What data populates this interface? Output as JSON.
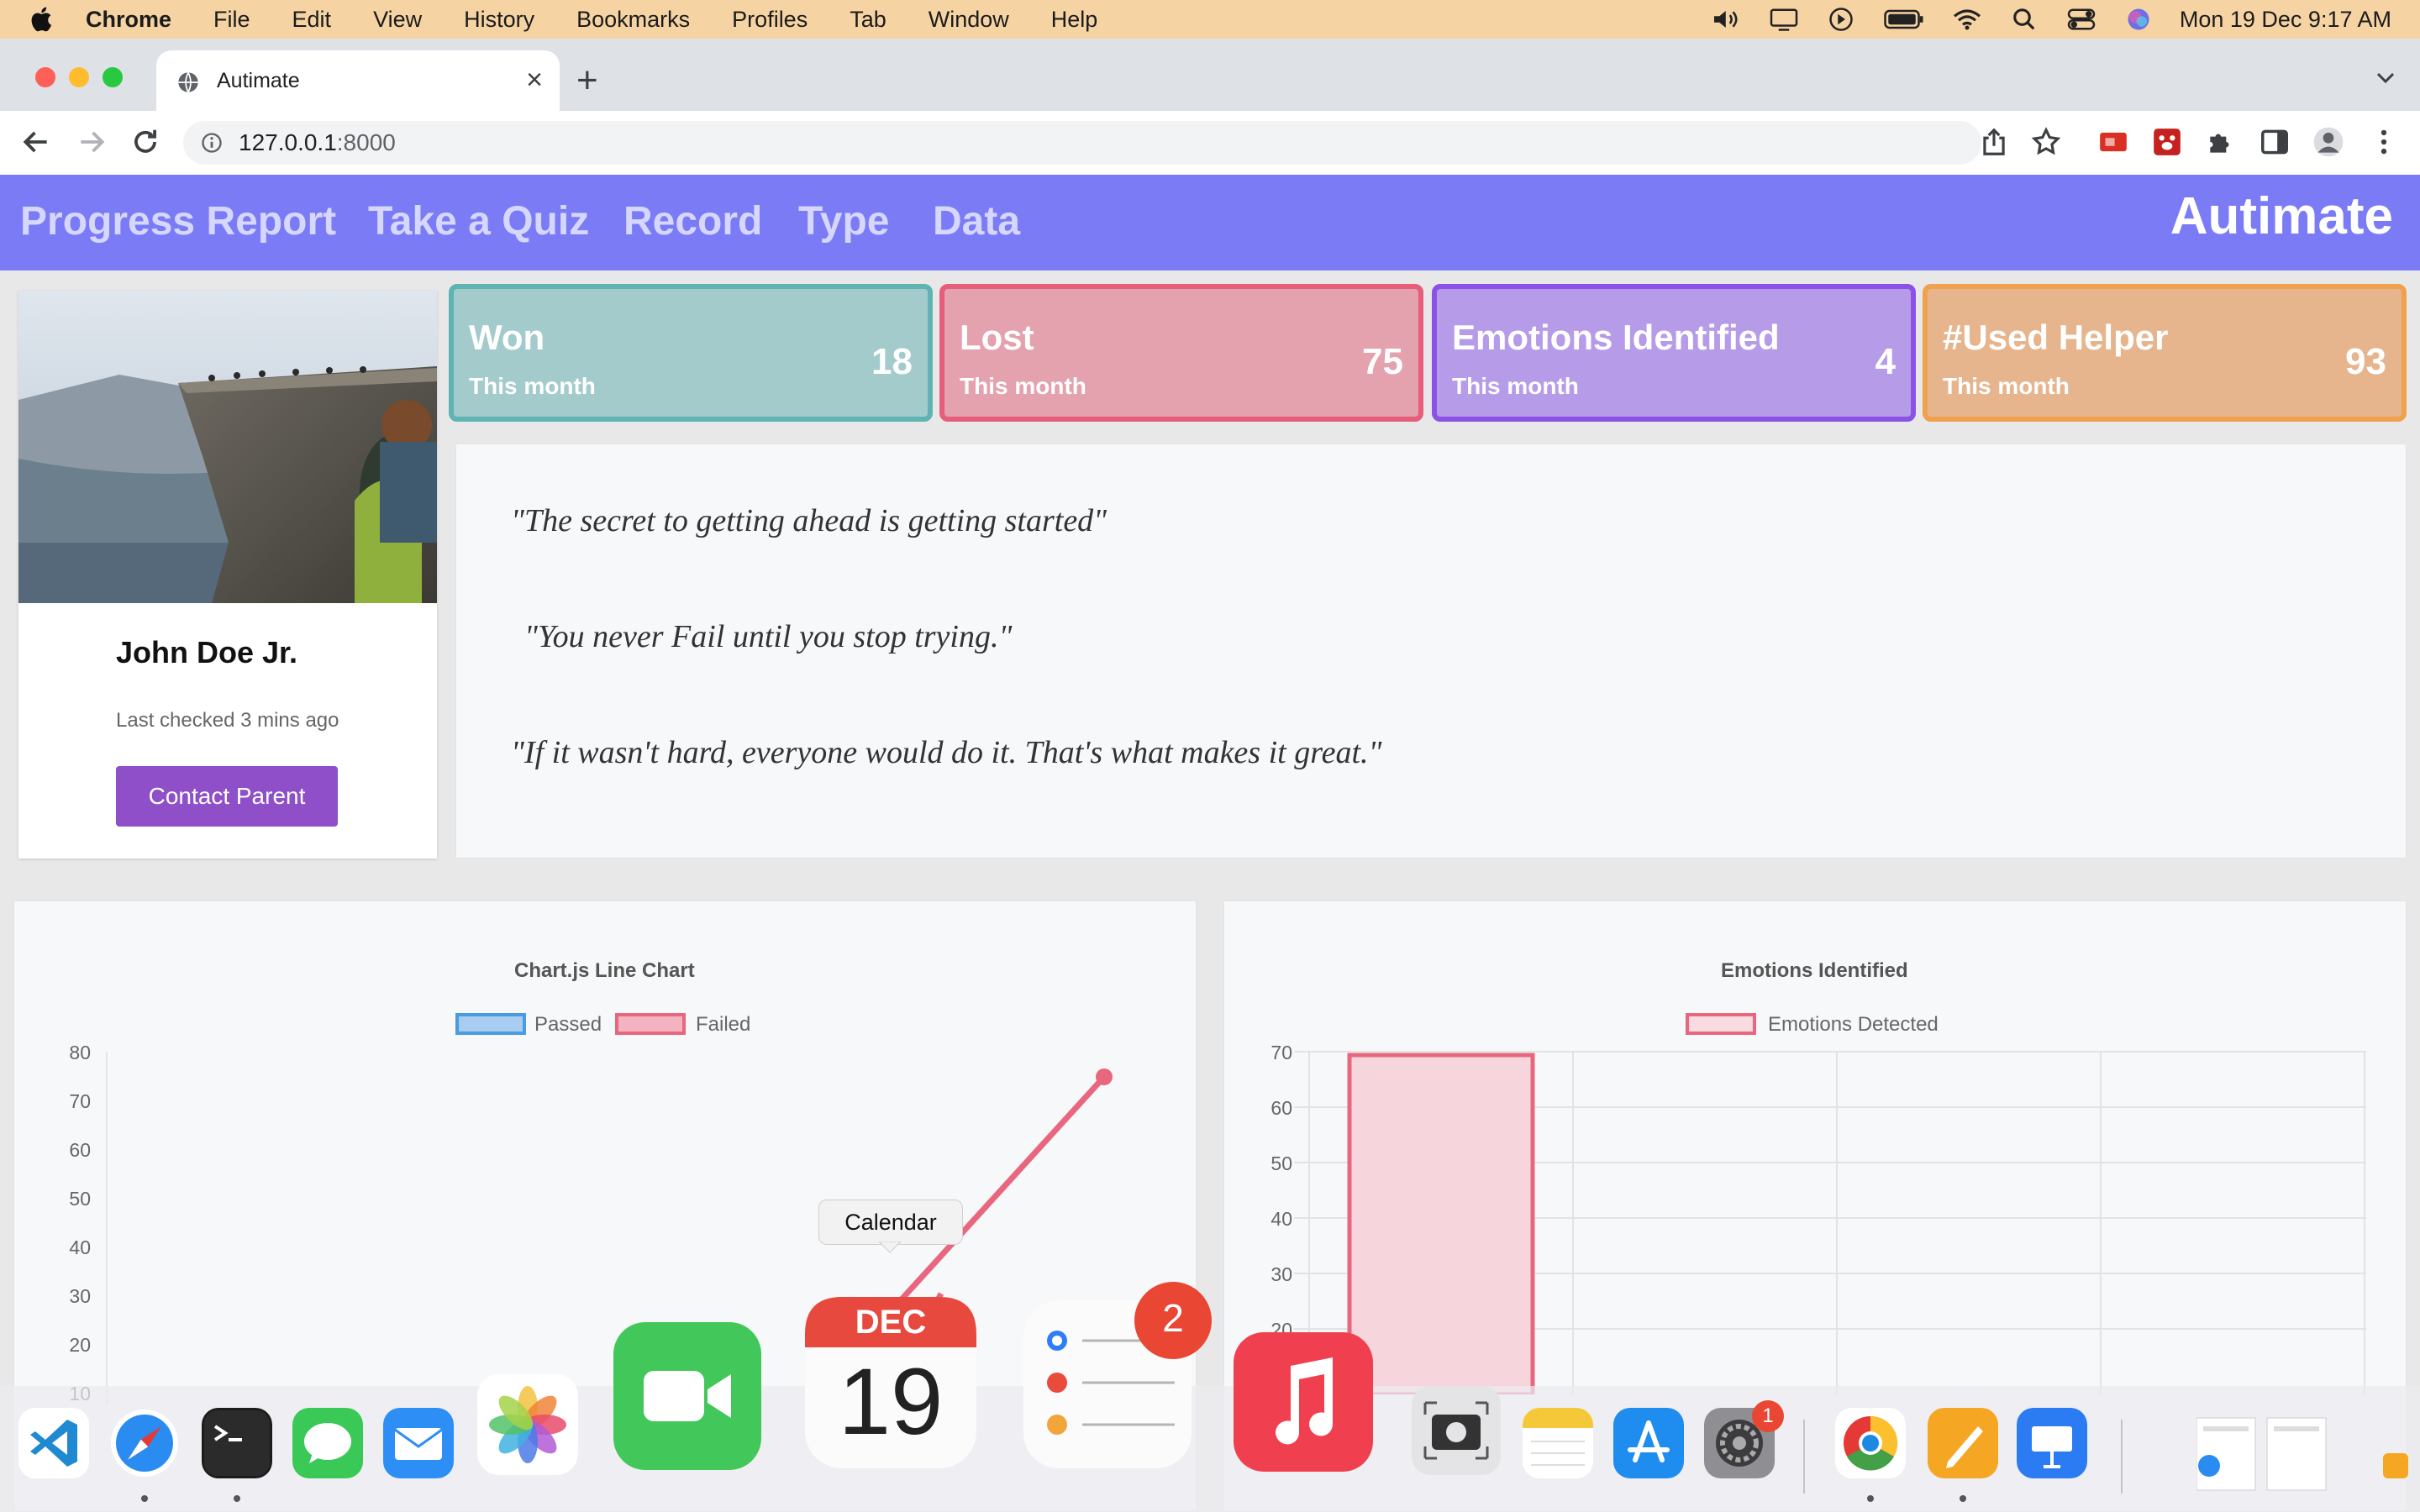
{
  "menubar": {
    "app": "Chrome",
    "items": [
      "File",
      "Edit",
      "View",
      "History",
      "Bookmarks",
      "Profiles",
      "Tab",
      "Window",
      "Help"
    ],
    "datetime": "Mon 19 Dec  9:17 AM"
  },
  "browser": {
    "tab_title": "Autimate",
    "url_host": "127.0.0.1",
    "url_port": ":8000"
  },
  "nav": {
    "links": [
      "Progress Report",
      "Take a Quiz",
      "Record",
      "Type",
      "Data"
    ],
    "brand": "Autimate"
  },
  "profile": {
    "name": "John Doe Jr.",
    "last_checked": "Last checked 3 mins ago",
    "contact_button": "Contact Parent"
  },
  "stats": [
    {
      "label": "Won",
      "sub": "This month",
      "value": "18",
      "bg": "#a3cbcb",
      "border": "#5fb3b3"
    },
    {
      "label": "Lost",
      "sub": "This month",
      "value": "75",
      "bg": "#e4a1ae",
      "border": "#e75d7a"
    },
    {
      "label": "Emotions Identified",
      "sub": "This month",
      "value": "4",
      "bg": "#b69be8",
      "border": "#8c52e6"
    },
    {
      "label": "#Used Helper",
      "sub": "This month",
      "value": "93",
      "bg": "#e6b58e",
      "border": "#f0a14e"
    }
  ],
  "quotes": [
    "\"The secret to getting ahead is getting started\"",
    "\"You never Fail until you stop trying.\"",
    "\"If it wasn't hard, everyone would do it. That's what makes it great.\""
  ],
  "chart_data": [
    {
      "type": "line",
      "title": "Chart.js Line Chart",
      "series": [
        {
          "name": "Passed",
          "color": "#4a9be0",
          "values": []
        },
        {
          "name": "Failed",
          "color": "#e8677f",
          "values": [
            70
          ]
        }
      ],
      "y_ticks": [
        "80",
        "70",
        "60",
        "50",
        "40",
        "30",
        "20",
        "10"
      ],
      "ylim": [
        0,
        80
      ],
      "legend": "top",
      "grid": false
    },
    {
      "type": "bar",
      "title": "Emotions Identified",
      "series": [
        {
          "name": "Emotions Detected",
          "color": "#e8677f",
          "values": [
            70
          ]
        }
      ],
      "y_ticks": [
        "70",
        "60",
        "50",
        "40",
        "30",
        "20"
      ],
      "ylim": [
        0,
        70
      ],
      "legend": "top",
      "grid": true
    }
  ],
  "dock": {
    "tooltip": "Calendar",
    "calendar_month": "DEC",
    "calendar_day": "19",
    "reminders_badge": "2",
    "settings_badge": "1",
    "apps": [
      "vscode-icon",
      "safari-icon",
      "terminal-icon",
      "messages-icon",
      "mail-icon",
      "photos-icon",
      "facetime-icon",
      "calendar-icon",
      "reminders-icon",
      "music-icon",
      "screenshot-icon",
      "notes-icon",
      "app-store-icon",
      "system-settings-icon",
      "chrome-icon",
      "pages-icon",
      "keynote-icon"
    ]
  }
}
